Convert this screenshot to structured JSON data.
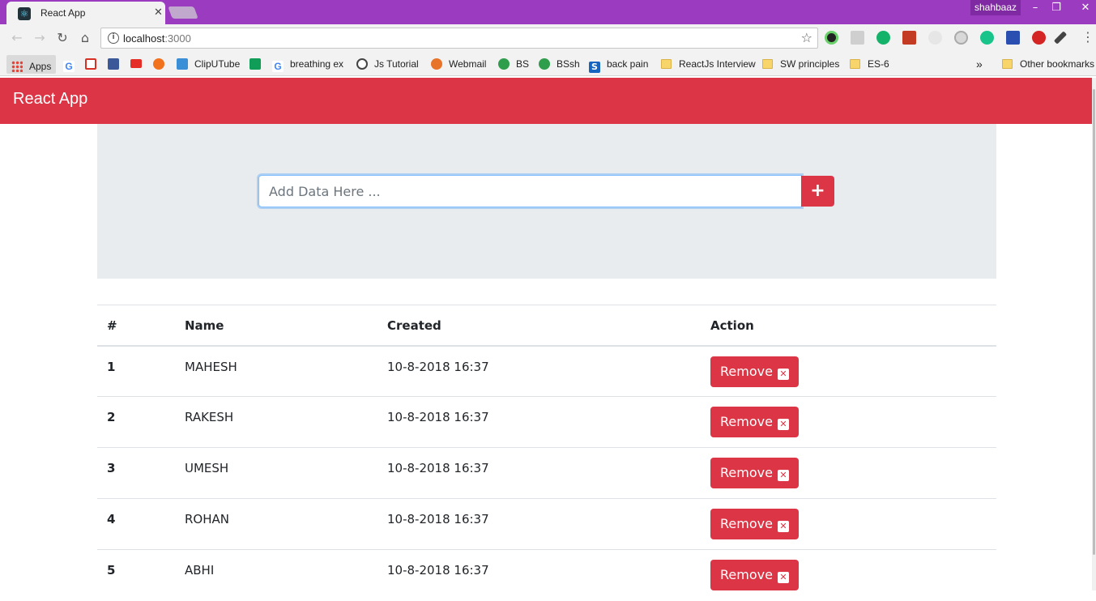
{
  "browser": {
    "tab_title": "React App",
    "profile_name": "shahbaaz",
    "url_host": "localhost",
    "url_port": ":3000",
    "bookmarks": {
      "apps": "Apps",
      "cliputube": "ClipUTube",
      "breathing": "breathing ex",
      "js_tutorial": "Js Tutorial",
      "webmail": "Webmail",
      "bs": "BS",
      "bssh": "BSsh",
      "back_pain": "back pain",
      "reactjs_interview": "ReactJs Interview",
      "sw_principles": "SW principles",
      "es6": "ES-6",
      "overflow": "»",
      "other": "Other bookmarks"
    }
  },
  "app": {
    "brand": "React App",
    "input_placeholder": "Add Data Here ...",
    "add_button": "+",
    "table": {
      "headers": [
        "#",
        "Name",
        "Created",
        "Action"
      ],
      "rows": [
        {
          "num": "1",
          "name": "MAHESH",
          "created": "10-8-2018 16:37",
          "action": "Remove"
        },
        {
          "num": "2",
          "name": "RAKESH",
          "created": "10-8-2018 16:37",
          "action": "Remove"
        },
        {
          "num": "3",
          "name": "UMESH",
          "created": "10-8-2018 16:37",
          "action": "Remove"
        },
        {
          "num": "4",
          "name": "ROHAN",
          "created": "10-8-2018 16:37",
          "action": "Remove"
        },
        {
          "num": "5",
          "name": "ABHI",
          "created": "10-8-2018 16:37",
          "action": "Remove"
        }
      ]
    }
  },
  "colors": {
    "titlebar": "#9b3bbf",
    "primary_red": "#dc3545",
    "jumbotron": "#e9ecef"
  }
}
